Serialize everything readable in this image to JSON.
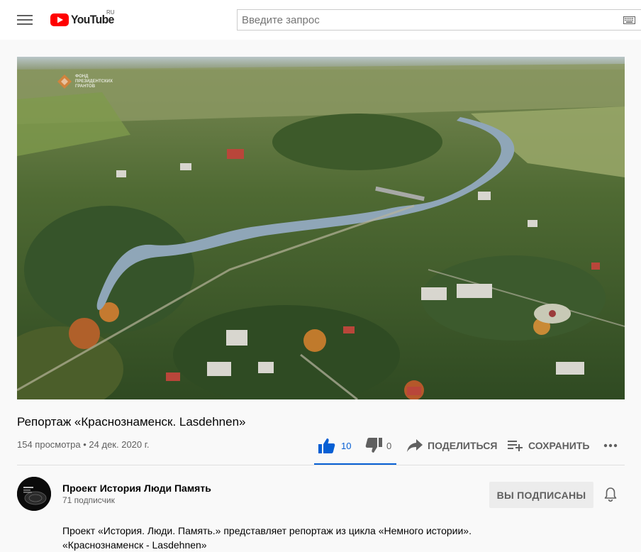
{
  "header": {
    "logo_text": "YouTube",
    "logo_region": "RU",
    "search_placeholder": "Введите запрос",
    "icons": [
      "menu-icon",
      "youtube-logo-icon",
      "keyboard-icon"
    ]
  },
  "colors": {
    "brand_red": "#ff0000",
    "accent_blue": "#065fd4",
    "text_primary": "#030303",
    "text_secondary": "#606060",
    "subscribe_bg": "#ececec"
  },
  "player": {
    "watermark": "Фонд президентских грантов"
  },
  "video": {
    "title": "Репортаж «Краснознаменск. Lasdehnen»",
    "views": "154 просмотра",
    "separator": "•",
    "date": "24 дек. 2020 г."
  },
  "actions": {
    "likes": "10",
    "dislikes": "0",
    "share_label": "ПОДЕЛИТЬСЯ",
    "save_label": "СОХРАНИТЬ"
  },
  "channel": {
    "name": "Проект История Люди Память",
    "subscribers": "71 подписчик",
    "subscribe_label": "ВЫ ПОДПИСАНЫ"
  },
  "description": {
    "line1": "Проект «История. Люди. Память.» представляет репортаж из цикла «Немного истории».",
    "line2": "«Краснознаменск - Lasdehnen»"
  }
}
